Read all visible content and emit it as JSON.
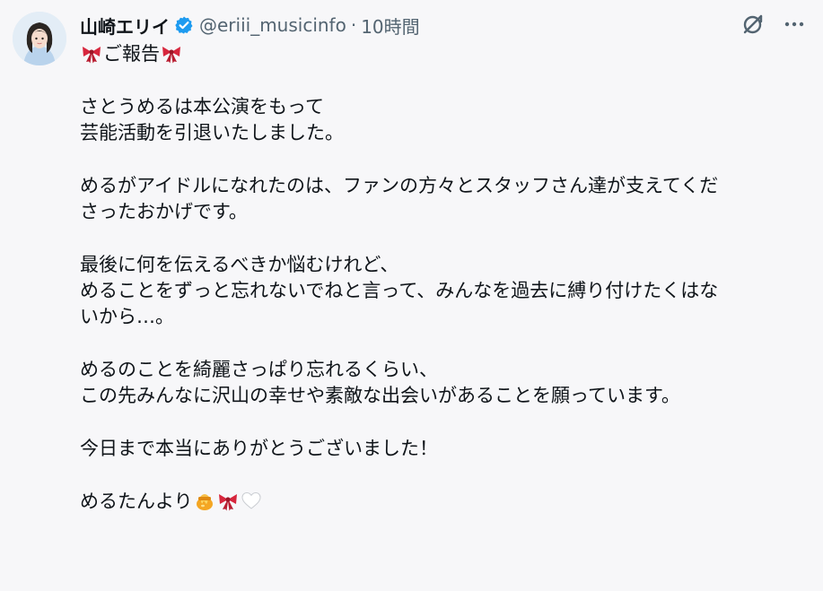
{
  "author": {
    "display_name": "山崎エリイ",
    "handle": "@eriii_musicinfo",
    "separator": "·",
    "time": "10時間"
  },
  "icons": {
    "verified": "verified-badge-icon",
    "grok": "grok-icon",
    "more": "more-icon",
    "ribbon": "ribbon-emoji",
    "honey": "honey-pot-emoji",
    "heart": "white-heart-emoji"
  },
  "colors": {
    "verified": "#1d9bf0",
    "ribbon": "#d7263d",
    "secondary_text": "#536471"
  },
  "post": {
    "title": "ご報告",
    "paragraph1": [
      "さとうめるは本公演をもって",
      "芸能活動を引退いたしました。"
    ],
    "paragraph2": [
      "めるがアイドルになれたのは、ファンの方々とスタッフさん達が支えてくだ",
      "さったおかげです。"
    ],
    "paragraph3": [
      "最後に何を伝えるべきか悩むけれど、",
      "めることをずっと忘れないでねと言って、みんなを過去に縛り付けたくはな",
      "いから…。"
    ],
    "paragraph4": [
      "めるのことを綺麗さっぱり忘れるくらい、",
      "この先みんなに沢山の幸せや素敵な出会いがあることを願っています。"
    ],
    "paragraph5": "今日まで本当にありがとうございました！",
    "signature": "めるたんより"
  }
}
